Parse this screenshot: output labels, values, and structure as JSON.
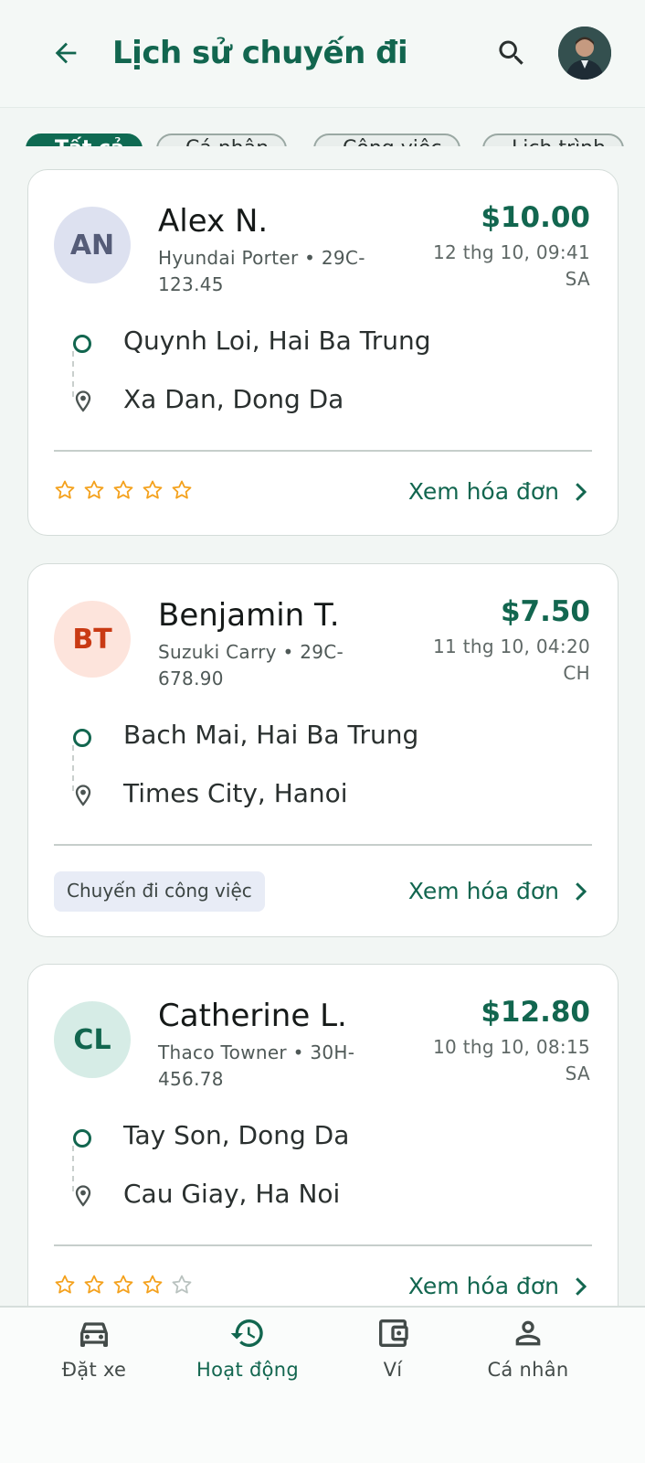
{
  "header": {
    "title": "Lịch sử chuyến đi",
    "back_icon": "arrow-left-icon",
    "search_icon": "search-icon"
  },
  "filters": [
    {
      "label": "Tất cả",
      "active": true
    },
    {
      "label": "Cá nhân",
      "active": false
    },
    {
      "label": "Công việc",
      "active": false
    },
    {
      "label": "Lịch trình",
      "active": false
    }
  ],
  "trips": [
    {
      "initials": "AN",
      "name": "Alex N.",
      "vehicle": "Hyundai Porter • 29C-123.45",
      "price": "$10.00",
      "time": "12 thg 10, 09:41 SA",
      "from": "Quynh Loi, Hai Ba Trung",
      "to": "Xa Dan, Dong Da",
      "rating": 5,
      "tag": "",
      "invoice": "Xem hóa đơn",
      "avatar_bg": "#dde1f0",
      "avatar_fg": "#555c78"
    },
    {
      "initials": "BT",
      "name": "Benjamin T.",
      "vehicle": "Suzuki Carry • 29C-678.90",
      "price": "$7.50",
      "time": "11 thg 10, 04:20 CH",
      "from": "Bach Mai, Hai Ba Trung",
      "to": "Times City, Hanoi",
      "rating": 0,
      "tag": "Chuyến đi công việc",
      "invoice": "Xem hóa đơn",
      "avatar_bg": "#fde4dc",
      "avatar_fg": "#c93a14"
    },
    {
      "initials": "CL",
      "name": "Catherine L.",
      "vehicle": "Thaco Towner • 30H-456.78",
      "price": "$12.80",
      "time": "10 thg 10, 08:15 SA",
      "from": "Tay Son, Dong Da",
      "to": "Cau Giay, Ha Noi",
      "rating": 4,
      "tag": "",
      "invoice": "Xem hóa đơn",
      "avatar_bg": "#d6ece6",
      "avatar_fg": "#12664f"
    }
  ],
  "bottom_nav": [
    {
      "label": "Đặt xe",
      "icon": "car-icon",
      "active": false
    },
    {
      "label": "Hoạt động",
      "icon": "history-icon",
      "active": true
    },
    {
      "label": "Ví",
      "icon": "wallet-icon",
      "active": false
    },
    {
      "label": "Cá nhân",
      "icon": "person-icon",
      "active": false
    }
  ],
  "colors": {
    "primary": "#12664f",
    "star": "#f4a11c",
    "star_empty": "#b9c2bf"
  }
}
